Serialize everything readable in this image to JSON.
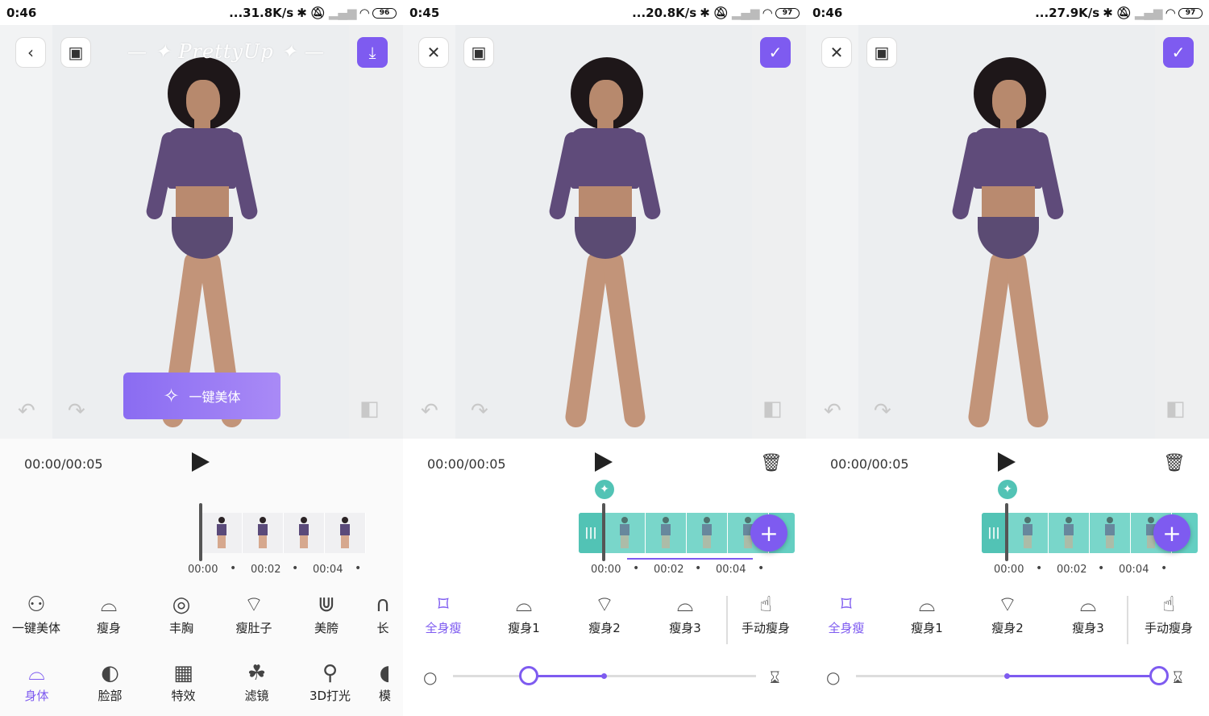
{
  "panels": [
    {
      "status": {
        "time": "0:46",
        "speed": "...31.8K/s",
        "battery": "96"
      },
      "logo": "PrettyUp",
      "one_key_label": "一键美体",
      "timecode": "00:00/00:05",
      "ticks": [
        "00:00",
        "00:02",
        "00:04"
      ],
      "tools": [
        {
          "label": "一键美体",
          "icon": "body-auto-icon"
        },
        {
          "label": "瘦身",
          "icon": "slim-icon"
        },
        {
          "label": "丰胸",
          "icon": "bust-icon"
        },
        {
          "label": "瘦肚子",
          "icon": "belly-icon"
        },
        {
          "label": "美胯",
          "icon": "hip-icon"
        },
        {
          "label": "长",
          "icon": "leg-icon"
        }
      ],
      "tabs": [
        {
          "label": "身体",
          "icon": "body-icon"
        },
        {
          "label": "脸部",
          "icon": "face-icon"
        },
        {
          "label": "特效",
          "icon": "effects-icon"
        },
        {
          "label": "滤镜",
          "icon": "filter-icon"
        },
        {
          "label": "3D打光",
          "icon": "light-icon"
        },
        {
          "label": "模",
          "icon": "model-icon"
        }
      ]
    },
    {
      "status": {
        "time": "0:45",
        "speed": "...20.8K/s",
        "battery": "97"
      },
      "timecode": "00:00/00:05",
      "ticks": [
        "00:00",
        "00:02",
        "00:04"
      ],
      "tools": [
        {
          "label": "全身瘦",
          "icon": "full-slim-icon"
        },
        {
          "label": "瘦身1",
          "icon": "slim1-icon"
        },
        {
          "label": "瘦身2",
          "icon": "slim2-icon"
        },
        {
          "label": "瘦身3",
          "icon": "slim3-icon"
        },
        {
          "label": "手动瘦身",
          "icon": "manual-slim-icon"
        }
      ],
      "slider_value": 0.25
    },
    {
      "status": {
        "time": "0:46",
        "speed": "...27.9K/s",
        "battery": "97"
      },
      "timecode": "00:00/00:05",
      "ticks": [
        "00:00",
        "00:02",
        "00:04"
      ],
      "tools": [
        {
          "label": "全身瘦",
          "icon": "full-slim-icon"
        },
        {
          "label": "瘦身1",
          "icon": "slim1-icon"
        },
        {
          "label": "瘦身2",
          "icon": "slim2-icon"
        },
        {
          "label": "瘦身3",
          "icon": "slim3-icon"
        },
        {
          "label": "手动瘦身",
          "icon": "manual-slim-icon"
        }
      ],
      "slider_value": 1.0
    }
  ],
  "colors": {
    "accent": "#7e5bf0",
    "teal": "#64cfc2"
  }
}
